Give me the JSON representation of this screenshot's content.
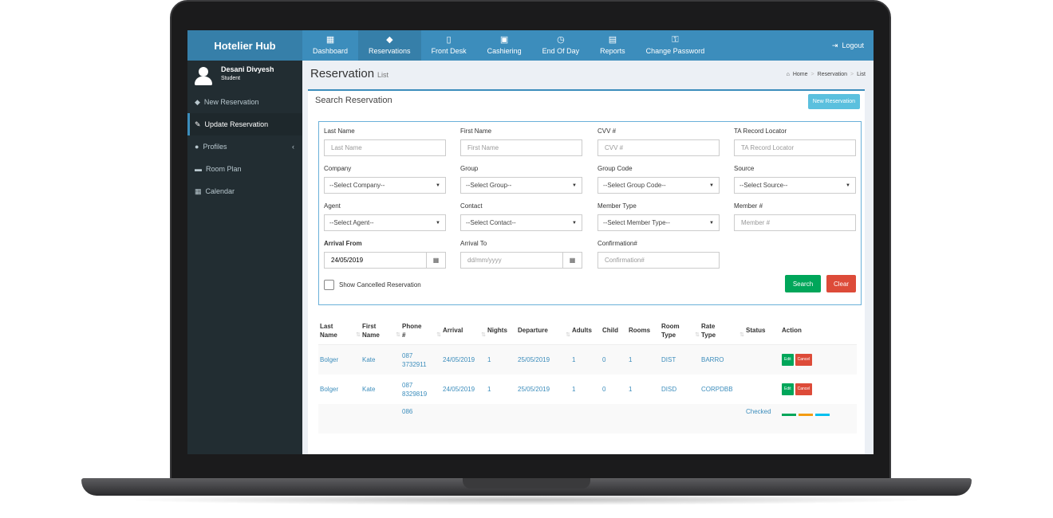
{
  "app": {
    "brand": "Hotelier Hub",
    "logout_label": "Logout"
  },
  "topnav": [
    {
      "label": "Dashboard",
      "icon": "grid-icon",
      "glyph": "▦"
    },
    {
      "label": "Reservations",
      "icon": "tag-icon",
      "glyph": "◆"
    },
    {
      "label": "Front Desk",
      "icon": "building-icon",
      "glyph": "▯"
    },
    {
      "label": "Cashiering",
      "icon": "money-icon",
      "glyph": "▣"
    },
    {
      "label": "End Of Day",
      "icon": "clock-icon",
      "glyph": "◷"
    },
    {
      "label": "Reports",
      "icon": "file-icon",
      "glyph": "▤"
    },
    {
      "label": "Change Password",
      "icon": "key-icon",
      "glyph": "⚿"
    }
  ],
  "user": {
    "name": "Desani Divyesh",
    "role": "Student"
  },
  "sidebar": [
    {
      "label": "New Reservation",
      "icon": "tag-icon",
      "glyph": "◆"
    },
    {
      "label": "Update Reservation",
      "icon": "edit-icon",
      "glyph": "✎"
    },
    {
      "label": "Profiles",
      "icon": "user-icon",
      "glyph": "●",
      "chevron": "‹"
    },
    {
      "label": "Room Plan",
      "icon": "bed-icon",
      "glyph": "▬"
    },
    {
      "label": "Calendar",
      "icon": "calendar-icon",
      "glyph": "▦"
    }
  ],
  "page": {
    "title": "Reservation",
    "subtitle": "List",
    "breadcrumb": [
      "Home",
      "Reservation",
      "List"
    ],
    "section_title": "Search Reservation",
    "new_reservation_label": "New Reservation"
  },
  "form": {
    "last_name": {
      "label": "Last Name",
      "placeholder": "Last Name"
    },
    "first_name": {
      "label": "First Name",
      "placeholder": "First Name"
    },
    "cvv": {
      "label": "CVV #",
      "placeholder": "CVV #"
    },
    "ta_locator": {
      "label": "TA Record Locator",
      "placeholder": "TA Record Locator"
    },
    "company": {
      "label": "Company",
      "value": "--Select Company--"
    },
    "group": {
      "label": "Group",
      "value": "--Select Group--"
    },
    "group_code": {
      "label": "Group Code",
      "value": "--Select Group Code--"
    },
    "source": {
      "label": "Source",
      "value": "--Select Source--"
    },
    "agent": {
      "label": "Agent",
      "value": "--Select Agent--"
    },
    "contact": {
      "label": "Contact",
      "value": "--Select Contact--"
    },
    "member_type": {
      "label": "Member Type",
      "value": "--Select Member Type--"
    },
    "member_no": {
      "label": "Member #",
      "placeholder": "Member #"
    },
    "arrival_from": {
      "label": "Arrival From",
      "value": "24/05/2019"
    },
    "arrival_to": {
      "label": "Arrival To",
      "placeholder": "dd/mm/yyyy"
    },
    "confirmation": {
      "label": "Confirmation#",
      "placeholder": "Confirmation#"
    },
    "show_cancelled": "Show Cancelled Reservation",
    "search_label": "Search",
    "clear_label": "Clear"
  },
  "table": {
    "headers": [
      [
        "Last",
        "Name"
      ],
      [
        "First",
        "Name"
      ],
      [
        "Phone",
        "#"
      ],
      [
        "Arrival",
        ""
      ],
      [
        "Nights",
        ""
      ],
      [
        "Departure",
        ""
      ],
      [
        "Adults",
        ""
      ],
      [
        "Child",
        ""
      ],
      [
        "Rooms",
        ""
      ],
      [
        "Room",
        "Type"
      ],
      [
        "Rate",
        "Type"
      ],
      [
        "Status",
        ""
      ],
      [
        "Action",
        ""
      ]
    ],
    "rows": [
      {
        "last": "Bolger",
        "first": "Kate",
        "phone1": "087",
        "phone2": "3732911",
        "arrival": "24/05/2019",
        "nights": "1",
        "departure": "25/05/2019",
        "adults": "1",
        "child": "0",
        "rooms": "1",
        "room_type": "DIST",
        "rate_type": "BARRO",
        "status": "",
        "edit": "Edit",
        "cancel": "Cancel"
      },
      {
        "last": "Bolger",
        "first": "Kate",
        "phone1": "087",
        "phone2": "8329819",
        "arrival": "24/05/2019",
        "nights": "1",
        "departure": "25/05/2019",
        "adults": "1",
        "child": "0",
        "rooms": "1",
        "room_type": "DISD",
        "rate_type": "CORPDBB",
        "status": "",
        "edit": "Edit",
        "cancel": "Cancel"
      },
      {
        "phone1": "086",
        "status": "Checked"
      }
    ]
  }
}
